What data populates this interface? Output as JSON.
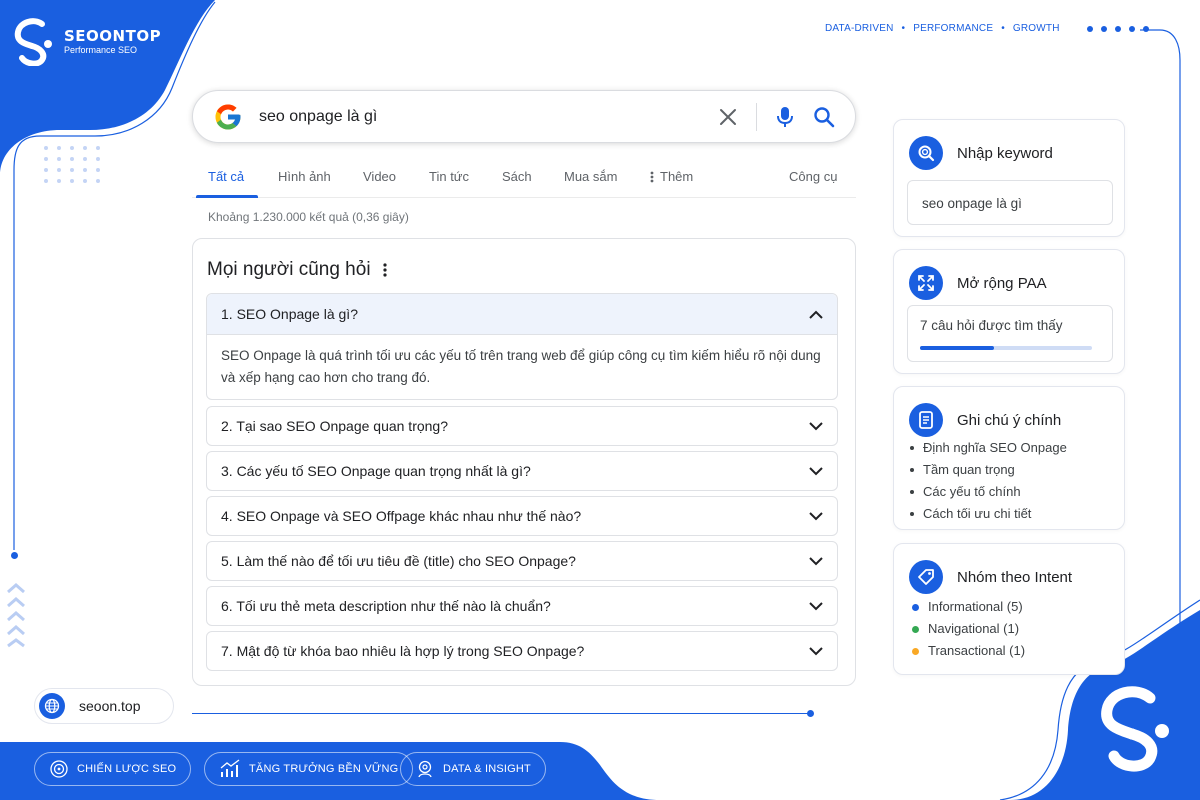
{
  "brand": {
    "name": "SEOONTOP",
    "tagline": "Performance SEO",
    "top_tagline": [
      "DATA-DRIVEN",
      "PERFORMANCE",
      "GROWTH"
    ],
    "separator": "•",
    "primary_color": "#1a5fe0"
  },
  "search": {
    "query": "seo onpage là gì",
    "icons": [
      "google-logo",
      "clear-icon",
      "mic-icon",
      "search-icon"
    ]
  },
  "tabs": {
    "items": [
      "Tất cả",
      "Hình ảnh",
      "Video",
      "Tin tức",
      "Sách",
      "Mua sắm",
      "Thêm"
    ],
    "tools": "Công cụ",
    "active": "Tất cả"
  },
  "result_count": "Khoảng 1.230.000 kết quả (0,36 giây)",
  "paa": {
    "title": "Mọi người cũng hỏi",
    "questions": [
      {
        "text": "1. SEO Onpage là gì?",
        "expanded": true,
        "answer": "SEO Onpage là quá trình tối ưu các yếu tố trên trang web để giúp công cụ tìm kiếm hiểu rõ nội dung và xếp hạng cao hơn cho trang đó."
      },
      {
        "text": "2. Tại sao SEO Onpage quan trọng?",
        "expanded": false
      },
      {
        "text": "3. Các yếu tố SEO Onpage quan trọng nhất là gì?",
        "expanded": false
      },
      {
        "text": "4. SEO Onpage và SEO Offpage khác nhau như thế nào?",
        "expanded": false
      },
      {
        "text": "5. Làm thế nào để tối ưu tiêu đề (title) cho SEO Onpage?",
        "expanded": false
      },
      {
        "text": "6. Tối ưu thẻ meta description như thế nào là chuẩn?",
        "expanded": false
      },
      {
        "text": "7. Mật độ từ khóa bao nhiêu là hợp lý trong SEO Onpage?",
        "expanded": false
      }
    ]
  },
  "sidebar": {
    "keyword": {
      "title": "Nhập keyword",
      "value": "seo onpage là gì",
      "icon": "search-icon"
    },
    "expand": {
      "title": "Mở rộng PAA",
      "status": "7 câu hỏi được tìm thấy",
      "progress": 0.43,
      "icon": "expand-icon"
    },
    "notes": {
      "title": "Ghi chú ý chính",
      "items": [
        "Định nghĩa SEO Onpage",
        "Tầm quan trọng",
        "Các yếu tố chính",
        "Cách tối ưu chi tiết"
      ],
      "icon": "note-icon"
    },
    "intent": {
      "title": "Nhóm theo Intent",
      "icon": "tag-icon",
      "items": [
        {
          "label": "Informational (5)",
          "color": "#1a5fe0"
        },
        {
          "label": "Navigational (1)",
          "color": "#34a853"
        },
        {
          "label": "Transactional (1)",
          "color": "#f9a825"
        }
      ]
    }
  },
  "footer": {
    "site": "seoon.top",
    "pills": [
      "CHIẾN LƯỢC SEO",
      "TĂNG TRƯỞNG BỀN VỮNG",
      "DATA & INSIGHT"
    ]
  }
}
